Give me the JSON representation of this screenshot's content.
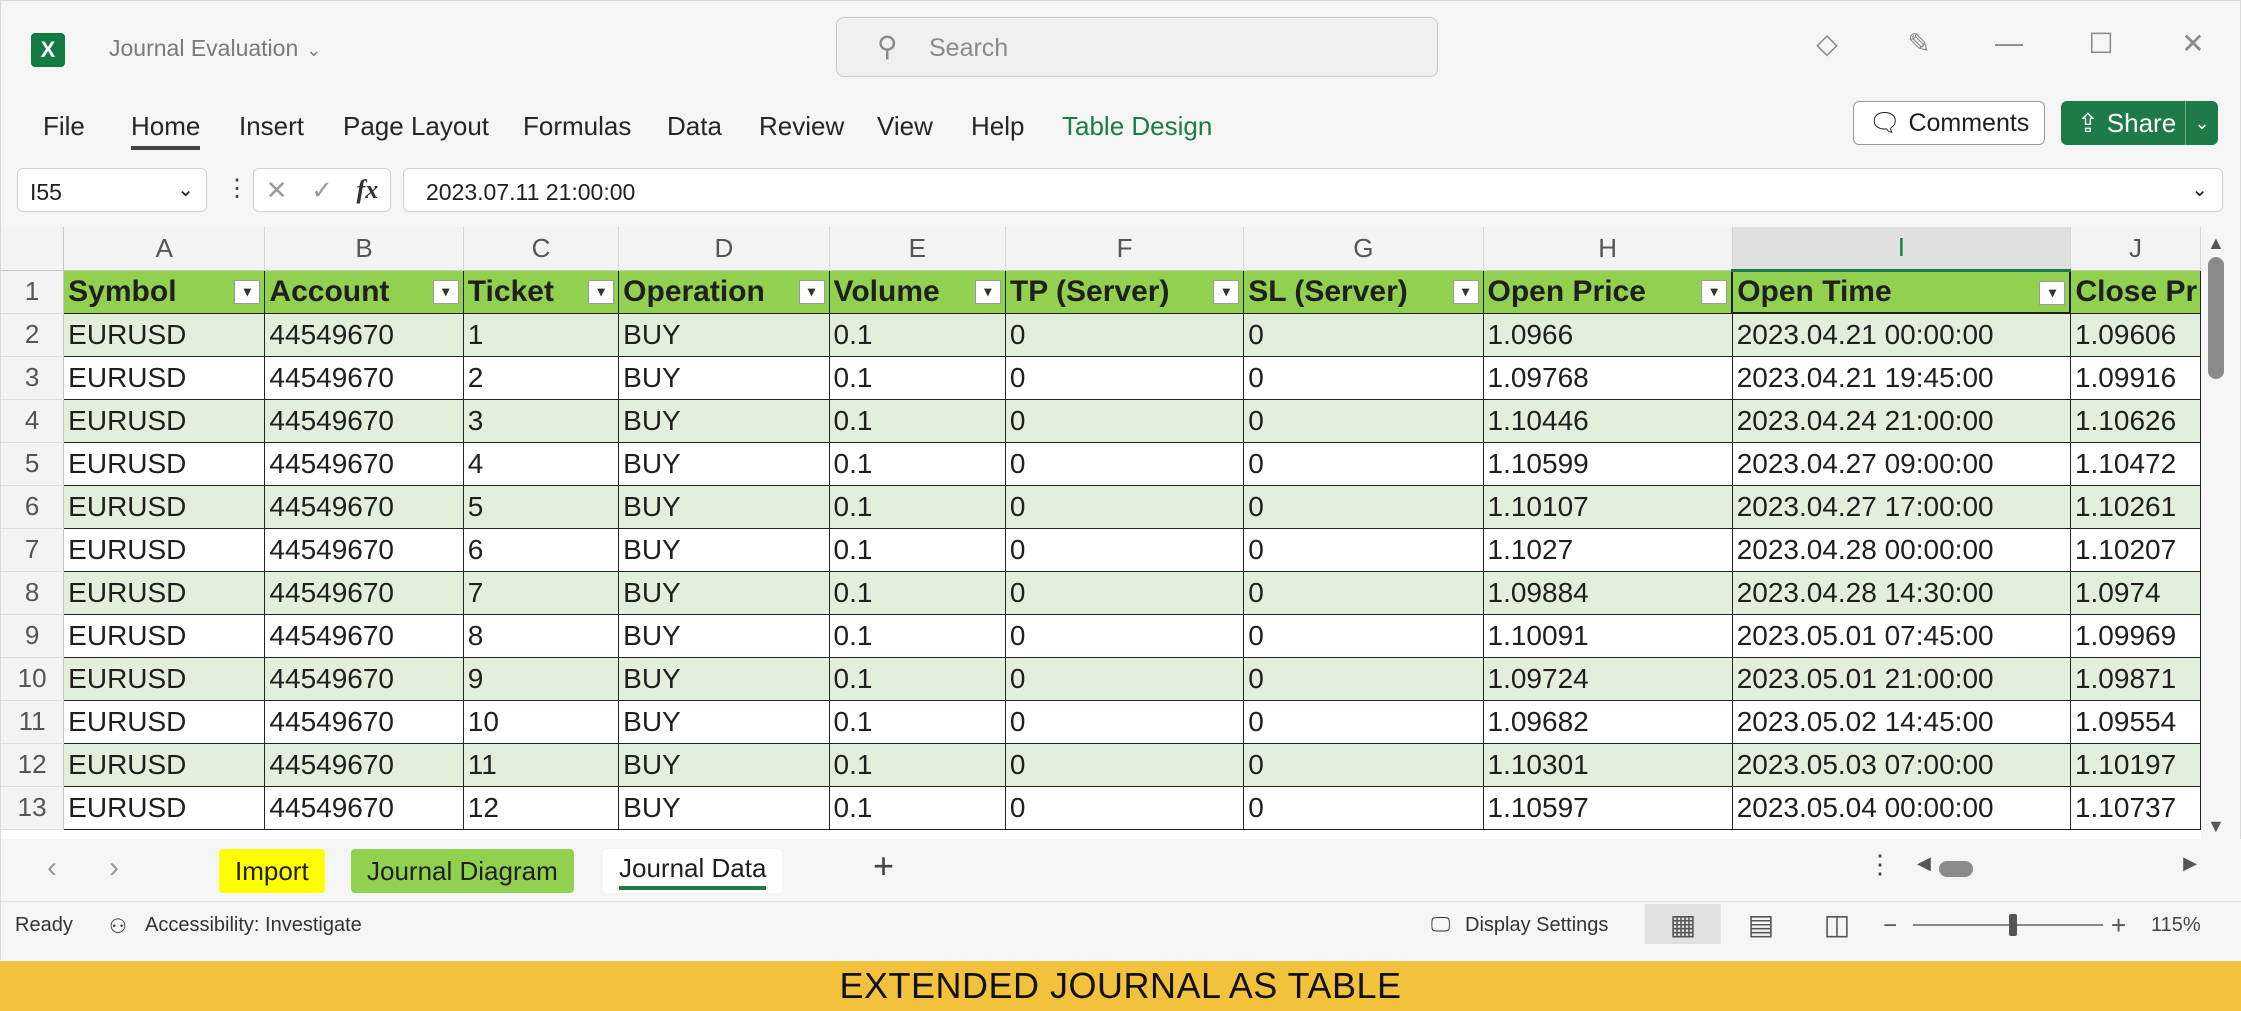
{
  "window": {
    "title": "Journal Evaluation",
    "search_placeholder": "Search"
  },
  "ribbon": {
    "tabs": [
      "File",
      "Home",
      "Insert",
      "Page Layout",
      "Formulas",
      "Data",
      "Review",
      "View",
      "Help",
      "Table Design"
    ],
    "comments_label": "Comments",
    "share_label": "Share"
  },
  "formula_bar": {
    "name_box": "I55",
    "formula": "2023.07.11 21:00:00"
  },
  "grid": {
    "column_letters": [
      "A",
      "B",
      "C",
      "D",
      "E",
      "F",
      "G",
      "H",
      "I",
      "J"
    ],
    "selected_column": "I",
    "headers": [
      "Symbol",
      "Account",
      "Ticket",
      "Operation",
      "Volume",
      "TP (Server)",
      "SL (Server)",
      "Open Price",
      "Open Time",
      "Close Pr"
    ],
    "rows": [
      {
        "num": "2",
        "cells": [
          "EURUSD",
          "44549670",
          "1",
          "BUY",
          "0.1",
          "0",
          "0",
          "1.0966",
          "2023.04.21 00:00:00",
          "1.09606"
        ]
      },
      {
        "num": "3",
        "cells": [
          "EURUSD",
          "44549670",
          "2",
          "BUY",
          "0.1",
          "0",
          "0",
          "1.09768",
          "2023.04.21 19:45:00",
          "1.09916"
        ]
      },
      {
        "num": "4",
        "cells": [
          "EURUSD",
          "44549670",
          "3",
          "BUY",
          "0.1",
          "0",
          "0",
          "1.10446",
          "2023.04.24 21:00:00",
          "1.10626"
        ]
      },
      {
        "num": "5",
        "cells": [
          "EURUSD",
          "44549670",
          "4",
          "BUY",
          "0.1",
          "0",
          "0",
          "1.10599",
          "2023.04.27 09:00:00",
          "1.10472"
        ]
      },
      {
        "num": "6",
        "cells": [
          "EURUSD",
          "44549670",
          "5",
          "BUY",
          "0.1",
          "0",
          "0",
          "1.10107",
          "2023.04.27 17:00:00",
          "1.10261"
        ]
      },
      {
        "num": "7",
        "cells": [
          "EURUSD",
          "44549670",
          "6",
          "BUY",
          "0.1",
          "0",
          "0",
          "1.1027",
          "2023.04.28 00:00:00",
          "1.10207"
        ]
      },
      {
        "num": "8",
        "cells": [
          "EURUSD",
          "44549670",
          "7",
          "BUY",
          "0.1",
          "0",
          "0",
          "1.09884",
          "2023.04.28 14:30:00",
          "1.0974"
        ]
      },
      {
        "num": "9",
        "cells": [
          "EURUSD",
          "44549670",
          "8",
          "BUY",
          "0.1",
          "0",
          "0",
          "1.10091",
          "2023.05.01 07:45:00",
          "1.09969"
        ]
      },
      {
        "num": "10",
        "cells": [
          "EURUSD",
          "44549670",
          "9",
          "BUY",
          "0.1",
          "0",
          "0",
          "1.09724",
          "2023.05.01 21:00:00",
          "1.09871"
        ]
      },
      {
        "num": "11",
        "cells": [
          "EURUSD",
          "44549670",
          "10",
          "BUY",
          "0.1",
          "0",
          "0",
          "1.09682",
          "2023.05.02 14:45:00",
          "1.09554"
        ]
      },
      {
        "num": "12",
        "cells": [
          "EURUSD",
          "44549670",
          "11",
          "BUY",
          "0.1",
          "0",
          "0",
          "1.10301",
          "2023.05.03 07:00:00",
          "1.10197"
        ]
      },
      {
        "num": "13",
        "cells": [
          "EURUSD",
          "44549670",
          "12",
          "BUY",
          "0.1",
          "0",
          "0",
          "1.10597",
          "2023.05.04 00:00:00",
          "1.10737"
        ]
      }
    ]
  },
  "sheet_tabs": {
    "import": "Import",
    "diagram": "Journal Diagram",
    "data": "Journal Data"
  },
  "status": {
    "ready": "Ready",
    "accessibility": "Accessibility: Investigate",
    "display_settings": "Display Settings",
    "zoom": "115%"
  },
  "caption": "EXTENDED JOURNAL AS TABLE",
  "colors": {
    "header_green": "#92d050",
    "band_green": "#e2efda",
    "excel_green": "#1e7a48",
    "import_tab": "#ffff00",
    "caption_bg": "#f2c23c"
  },
  "icons": [
    "excel-app-icon",
    "search-icon",
    "diamond-icon",
    "pen-icon",
    "minimize-icon",
    "maximize-icon",
    "close-icon",
    "comment-icon",
    "share-icon",
    "filter-dropdown-icon",
    "accessibility-icon",
    "display-settings-icon",
    "normal-view-icon",
    "page-layout-view-icon",
    "page-break-view-icon"
  ]
}
